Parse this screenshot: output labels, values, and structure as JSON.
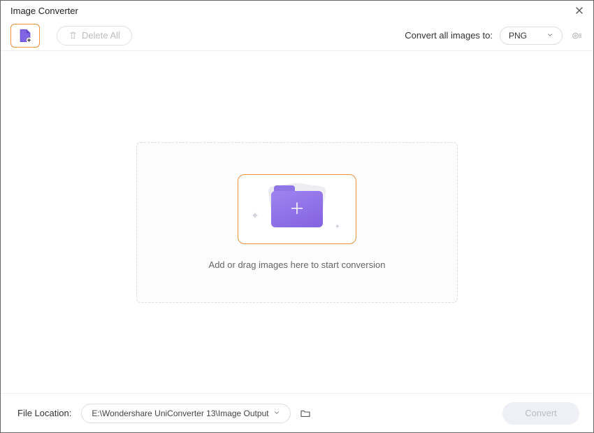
{
  "window": {
    "title": "Image Converter"
  },
  "toolbar": {
    "delete_all_label": "Delete All",
    "convert_to_label": "Convert all images to:",
    "format_selected": "PNG"
  },
  "dropzone": {
    "hint": "Add or drag images here to start conversion"
  },
  "footer": {
    "file_location_label": "File Location:",
    "file_location_value": "E:\\Wondershare UniConverter 13\\Image Output",
    "convert_label": "Convert"
  }
}
